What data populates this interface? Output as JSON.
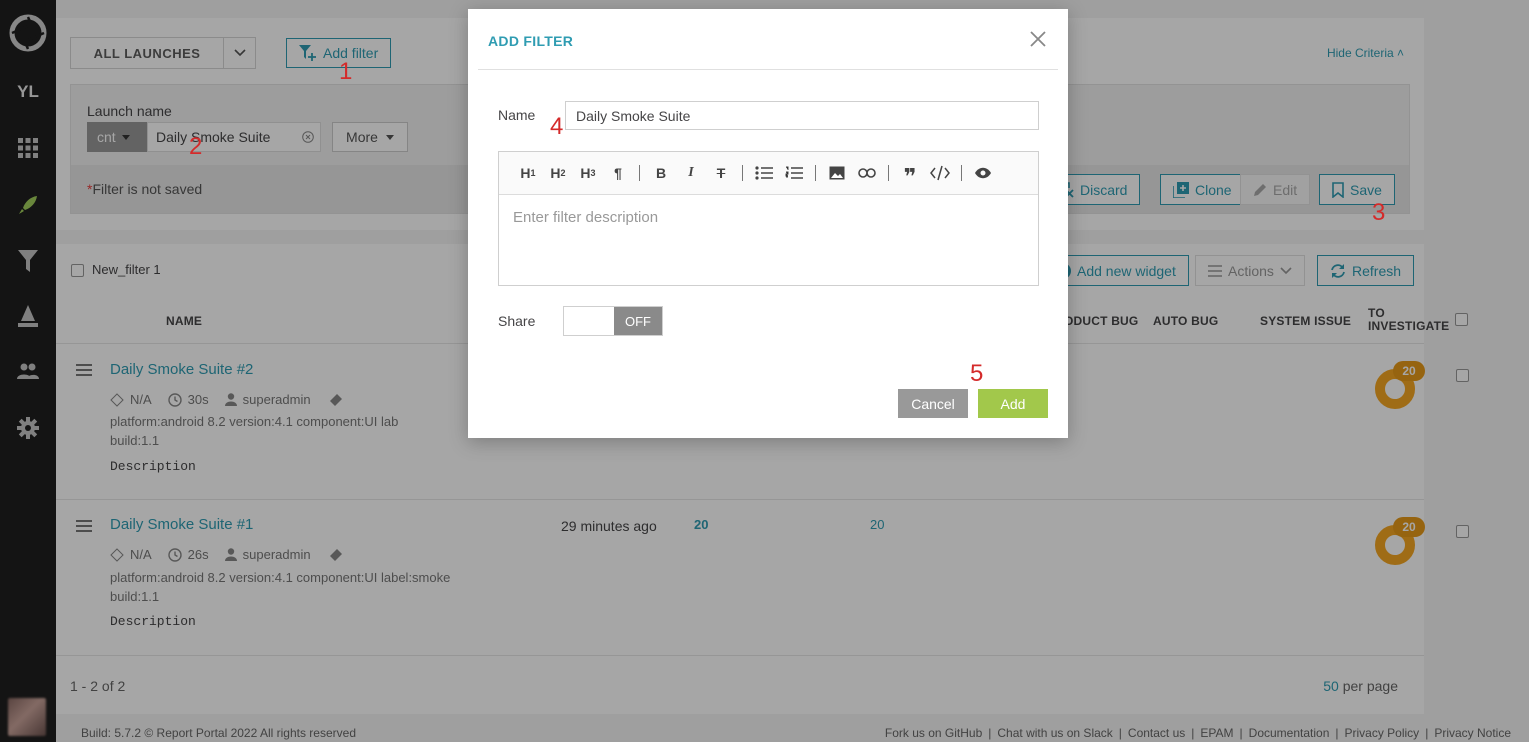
{
  "sidebar": {
    "user_initials": "YL",
    "items": [
      "dashboard-icon",
      "launches-icon",
      "filters-icon",
      "debug-icon",
      "members-icon",
      "settings-icon"
    ]
  },
  "toolbar": {
    "launch_select": "ALL LAUNCHES",
    "add_filter": "Add filter",
    "hide_criteria": "Hide Criteria"
  },
  "criteria": {
    "label": "Launch name",
    "condition": "cnt",
    "value": "Daily Smoke Suite",
    "more": "More",
    "warning_star": "*",
    "warning": "Filter is not saved",
    "discard": "Discard",
    "clone": "Clone",
    "edit": "Edit",
    "save": "Save"
  },
  "markers": [
    "1",
    "2",
    "3",
    "4",
    "5"
  ],
  "list": {
    "filter_name": "New_filter 1",
    "add_widget": "Add new widget",
    "actions": "Actions",
    "refresh": "Refresh",
    "columns": {
      "name": "NAME",
      "product_bug": "ODUCT BUG",
      "auto_bug": "AUTO BUG",
      "system_issue": "SYSTEM ISSUE",
      "to_investigate_1": "TO",
      "to_investigate_2": "INVESTIGATE"
    },
    "rows": [
      {
        "title": "Daily Smoke Suite #2",
        "na": "N/A",
        "duration": "30s",
        "owner": "superadmin",
        "attrs": "platform:android 8.2   version:4.1   component:UI   lab",
        "build": "build:1.1",
        "description": "Description",
        "ti": "20",
        "time": "",
        "total": "",
        "passed": ""
      },
      {
        "title": "Daily Smoke Suite #1",
        "na": "N/A",
        "duration": "26s",
        "owner": "superadmin",
        "attrs": "platform:android 8.2   version:4.1   component:UI   label:smoke",
        "build": "build:1.1",
        "description": "Description",
        "ti": "20",
        "time": "29 minutes ago",
        "total": "20",
        "passed": "20"
      }
    ],
    "pagination": "1 - 2 of 2",
    "per_page_value": "50",
    "per_page_label": " per page"
  },
  "footer": {
    "build": "Build: 5.7.2   © Report Portal 2022 All rights reserved",
    "links": [
      "Fork us on GitHub",
      "|",
      "Chat with us on Slack",
      "|",
      "Contact us",
      "|",
      "EPAM",
      "|",
      "Documentation",
      "|",
      "Privacy Policy",
      "|",
      "Privacy Notice"
    ]
  },
  "modal": {
    "title": "ADD FILTER",
    "name_label": "Name",
    "name_value": "Daily Smoke Suite",
    "editor_buttons": [
      "H1",
      "H2",
      "H3",
      "¶",
      "B",
      "I",
      "S",
      "•≡",
      "1≡",
      "img",
      "link",
      "❞",
      "</>",
      "eye"
    ],
    "description_placeholder": "Enter filter description",
    "share_label": "Share",
    "share_state": "OFF",
    "cancel": "Cancel",
    "add": "Add"
  }
}
